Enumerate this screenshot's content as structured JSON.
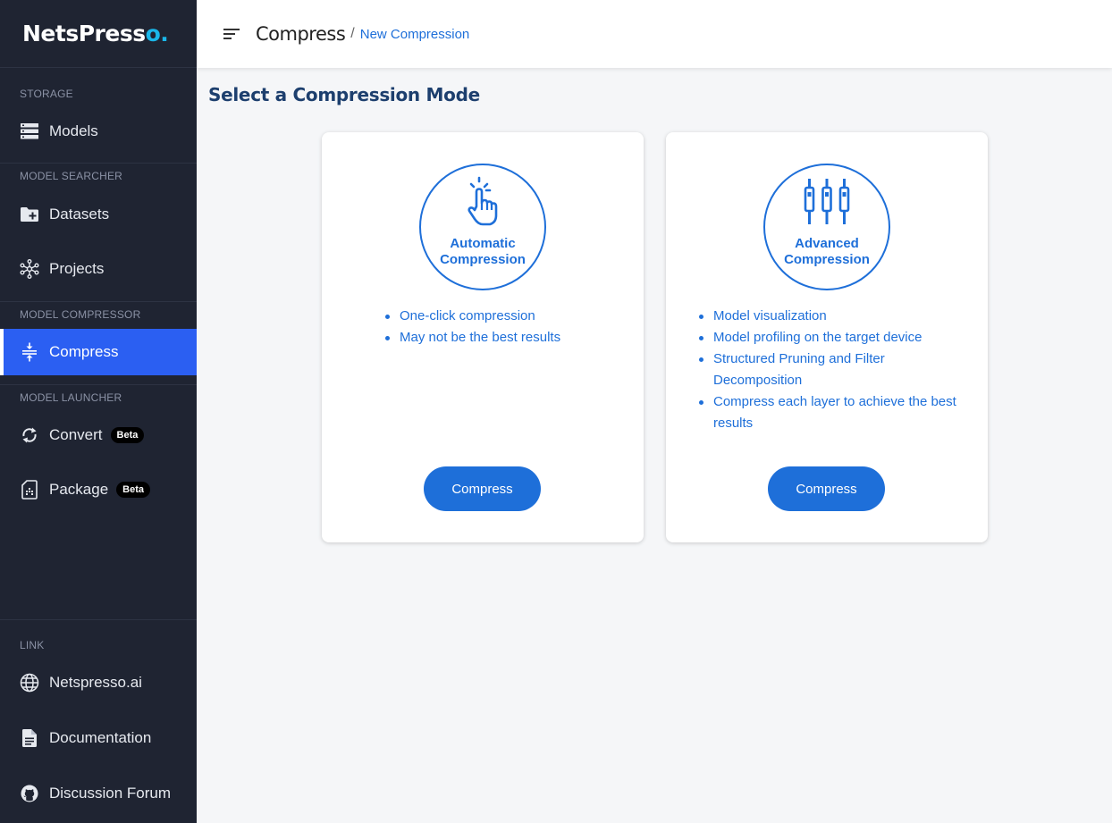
{
  "brand": {
    "logo_text": "NetsPress",
    "logo_end": "o",
    "logo_dot": "."
  },
  "sidebar": {
    "sections": {
      "storage": "STORAGE",
      "model_searcher": "MODEL SEARCHER",
      "model_compressor": "MODEL COMPRESSOR",
      "model_launcher": "MODEL LAUNCHER",
      "link": "LINK"
    },
    "items": {
      "models": "Models",
      "datasets": "Datasets",
      "projects": "Projects",
      "compress": "Compress",
      "convert": "Convert",
      "package": "Package",
      "netspresso_ai": "Netspresso.ai",
      "documentation": "Documentation",
      "discussion_forum": "Discussion Forum"
    },
    "badges": {
      "convert": "Beta",
      "package": "Beta"
    },
    "active_item": "compress"
  },
  "header": {
    "breadcrumb_main": "Compress",
    "breadcrumb_sep": "/",
    "breadcrumb_sub": "New Compression"
  },
  "main": {
    "title": "Select a Compression Mode",
    "cards": [
      {
        "mode_line1": "Automatic",
        "mode_line2": "Compression",
        "features": [
          "One-click compression",
          "May not be the best results"
        ],
        "button": "Compress"
      },
      {
        "mode_line1": "Advanced",
        "mode_line2": "Compression",
        "features": [
          "Model visualization",
          "Model profiling on the target device",
          "Structured Pruning and Filter Decomposition",
          "Compress each layer to achieve the best results"
        ],
        "button": "Compress"
      }
    ]
  },
  "colors": {
    "sidebar_bg": "#1f2432",
    "active_bg": "#2b5ff2",
    "accent": "#1e6fd9",
    "title": "#1d3f6e",
    "logo_dot": "#1ab7ea"
  },
  "icons": {
    "models": "storage-icon",
    "datasets": "folder-plus-icon",
    "projects": "network-icon",
    "compress": "compress-icon",
    "convert": "sync-icon",
    "package": "sim-card-icon",
    "netspresso_ai": "globe-icon",
    "documentation": "document-icon",
    "discussion_forum": "github-icon",
    "automatic": "touch-hand-icon",
    "advanced": "equalizer-icon"
  }
}
